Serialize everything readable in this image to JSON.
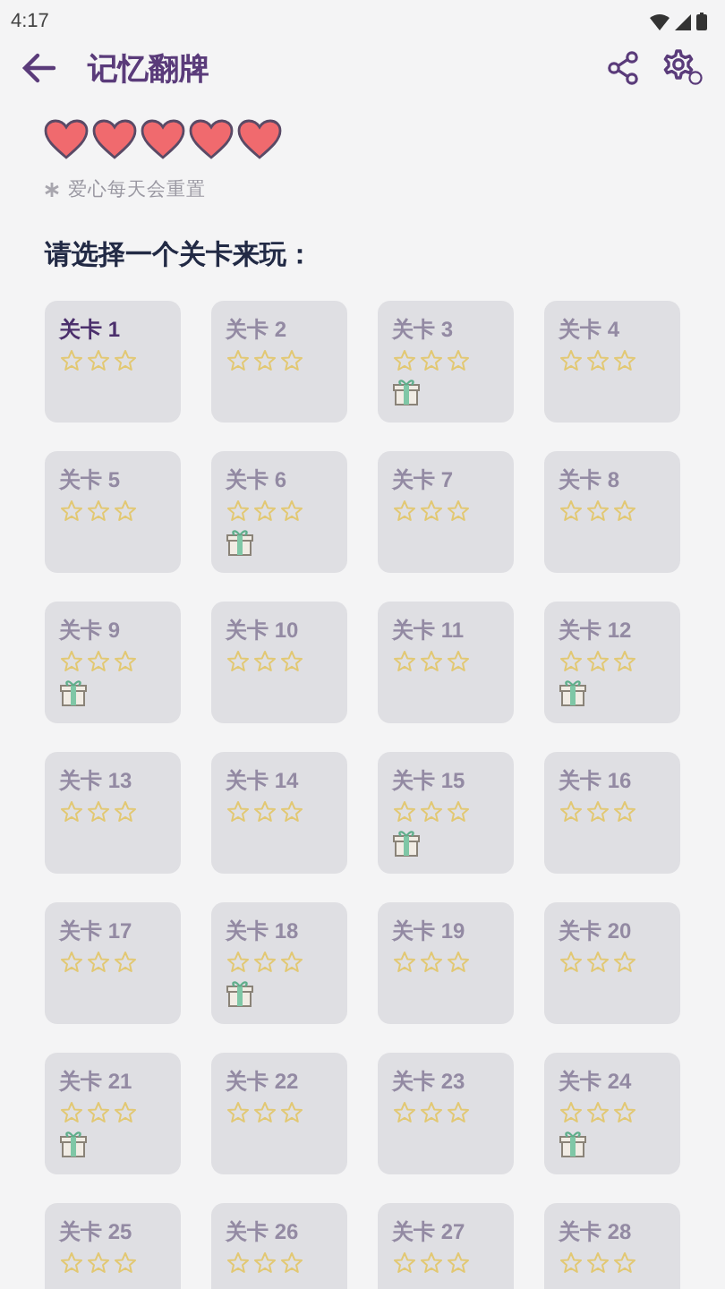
{
  "status_bar": {
    "time": "4:17"
  },
  "app_bar": {
    "title": "记忆翻牌"
  },
  "hearts": [
    {
      "filled": true
    },
    {
      "filled": true
    },
    {
      "filled": true
    },
    {
      "filled": true
    },
    {
      "filled": true
    }
  ],
  "note": "爱心每天会重置",
  "heading": "请选择一个关卡来玩：",
  "levels": [
    {
      "label": "关卡 1",
      "unlocked": true,
      "stars": 0,
      "gift": false
    },
    {
      "label": "关卡 2",
      "unlocked": false,
      "stars": 0,
      "gift": false
    },
    {
      "label": "关卡 3",
      "unlocked": false,
      "stars": 0,
      "gift": true
    },
    {
      "label": "关卡 4",
      "unlocked": false,
      "stars": 0,
      "gift": false
    },
    {
      "label": "关卡 5",
      "unlocked": false,
      "stars": 0,
      "gift": false
    },
    {
      "label": "关卡 6",
      "unlocked": false,
      "stars": 0,
      "gift": true
    },
    {
      "label": "关卡 7",
      "unlocked": false,
      "stars": 0,
      "gift": false
    },
    {
      "label": "关卡 8",
      "unlocked": false,
      "stars": 0,
      "gift": false
    },
    {
      "label": "关卡 9",
      "unlocked": false,
      "stars": 0,
      "gift": true
    },
    {
      "label": "关卡 10",
      "unlocked": false,
      "stars": 0,
      "gift": false
    },
    {
      "label": "关卡 11",
      "unlocked": false,
      "stars": 0,
      "gift": false
    },
    {
      "label": "关卡 12",
      "unlocked": false,
      "stars": 0,
      "gift": true
    },
    {
      "label": "关卡 13",
      "unlocked": false,
      "stars": 0,
      "gift": false
    },
    {
      "label": "关卡 14",
      "unlocked": false,
      "stars": 0,
      "gift": false
    },
    {
      "label": "关卡 15",
      "unlocked": false,
      "stars": 0,
      "gift": true
    },
    {
      "label": "关卡 16",
      "unlocked": false,
      "stars": 0,
      "gift": false
    },
    {
      "label": "关卡 17",
      "unlocked": false,
      "stars": 0,
      "gift": false
    },
    {
      "label": "关卡 18",
      "unlocked": false,
      "stars": 0,
      "gift": true
    },
    {
      "label": "关卡 19",
      "unlocked": false,
      "stars": 0,
      "gift": false
    },
    {
      "label": "关卡 20",
      "unlocked": false,
      "stars": 0,
      "gift": false
    },
    {
      "label": "关卡 21",
      "unlocked": false,
      "stars": 0,
      "gift": true
    },
    {
      "label": "关卡 22",
      "unlocked": false,
      "stars": 0,
      "gift": false
    },
    {
      "label": "关卡 23",
      "unlocked": false,
      "stars": 0,
      "gift": false
    },
    {
      "label": "关卡 24",
      "unlocked": false,
      "stars": 0,
      "gift": true
    },
    {
      "label": "关卡 25",
      "unlocked": false,
      "stars": 0,
      "gift": false
    },
    {
      "label": "关卡 26",
      "unlocked": false,
      "stars": 0,
      "gift": false
    },
    {
      "label": "关卡 27",
      "unlocked": false,
      "stars": 0,
      "gift": false
    },
    {
      "label": "关卡 28",
      "unlocked": false,
      "stars": 0,
      "gift": false
    }
  ]
}
